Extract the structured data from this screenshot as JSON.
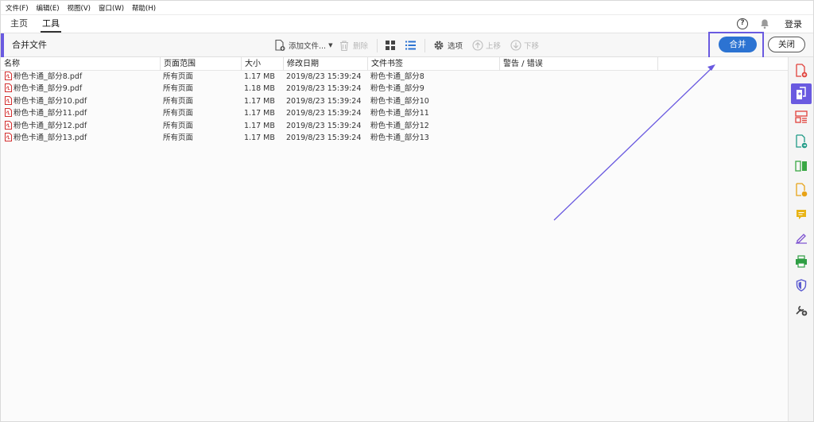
{
  "menu": [
    "文件(F)",
    "编辑(E)",
    "视图(V)",
    "窗口(W)",
    "帮助(H)"
  ],
  "nav": {
    "home": "主页",
    "tools": "工具",
    "help": "?",
    "login": "登录"
  },
  "toolbar": {
    "title": "合并文件",
    "add_files": "添加文件...",
    "delete": "删除",
    "options": "选项",
    "move_up": "上移",
    "move_down": "下移",
    "merge": "合并",
    "close": "关闭"
  },
  "table": {
    "columns": [
      "名称",
      "页面范围",
      "大小",
      "修改日期",
      "文件书签",
      "警告 / 错误"
    ],
    "rows": [
      {
        "name": "粉色卡通_部分8.pdf",
        "range": "所有页面",
        "size": "1.17 MB",
        "date": "2019/8/23 15:39:24",
        "bookmark": "粉色卡通_部分8",
        "warning": ""
      },
      {
        "name": "粉色卡通_部分9.pdf",
        "range": "所有页面",
        "size": "1.18 MB",
        "date": "2019/8/23 15:39:24",
        "bookmark": "粉色卡通_部分9",
        "warning": ""
      },
      {
        "name": "粉色卡通_部分10.pdf",
        "range": "所有页面",
        "size": "1.17 MB",
        "date": "2019/8/23 15:39:24",
        "bookmark": "粉色卡通_部分10",
        "warning": ""
      },
      {
        "name": "粉色卡通_部分11.pdf",
        "range": "所有页面",
        "size": "1.17 MB",
        "date": "2019/8/23 15:39:24",
        "bookmark": "粉色卡通_部分11",
        "warning": ""
      },
      {
        "name": "粉色卡通_部分12.pdf",
        "range": "所有页面",
        "size": "1.17 MB",
        "date": "2019/8/23 15:39:24",
        "bookmark": "粉色卡通_部分12",
        "warning": ""
      },
      {
        "name": "粉色卡通_部分13.pdf",
        "range": "所有页面",
        "size": "1.17 MB",
        "date": "2019/8/23 15:39:24",
        "bookmark": "粉色卡通_部分13",
        "warning": ""
      }
    ]
  },
  "sidebar_tools": [
    {
      "icon": "create-pdf-icon",
      "color": "#e0403a"
    },
    {
      "icon": "combine-files-icon",
      "color": "#6a5ae0",
      "active": true
    },
    {
      "icon": "organize-pages-icon",
      "color": "#e0403a"
    },
    {
      "icon": "export-pdf-icon",
      "color": "#1f9a86"
    },
    {
      "icon": "compare-icon",
      "color": "#3aa845"
    },
    {
      "icon": "enhance-scan-icon",
      "color": "#e8a317"
    },
    {
      "icon": "comment-icon",
      "color": "#e8b417"
    },
    {
      "icon": "fill-sign-icon",
      "color": "#7b4fd0"
    },
    {
      "icon": "print-production-icon",
      "color": "#2f9e44"
    },
    {
      "icon": "protect-icon",
      "color": "#5a5ad0"
    },
    {
      "icon": "more-tools-icon",
      "color": "#444444"
    }
  ],
  "colors": {
    "accent": "#6a5ae0",
    "primary_button": "#2c73d2",
    "pdf_icon": "#d32f2f"
  }
}
